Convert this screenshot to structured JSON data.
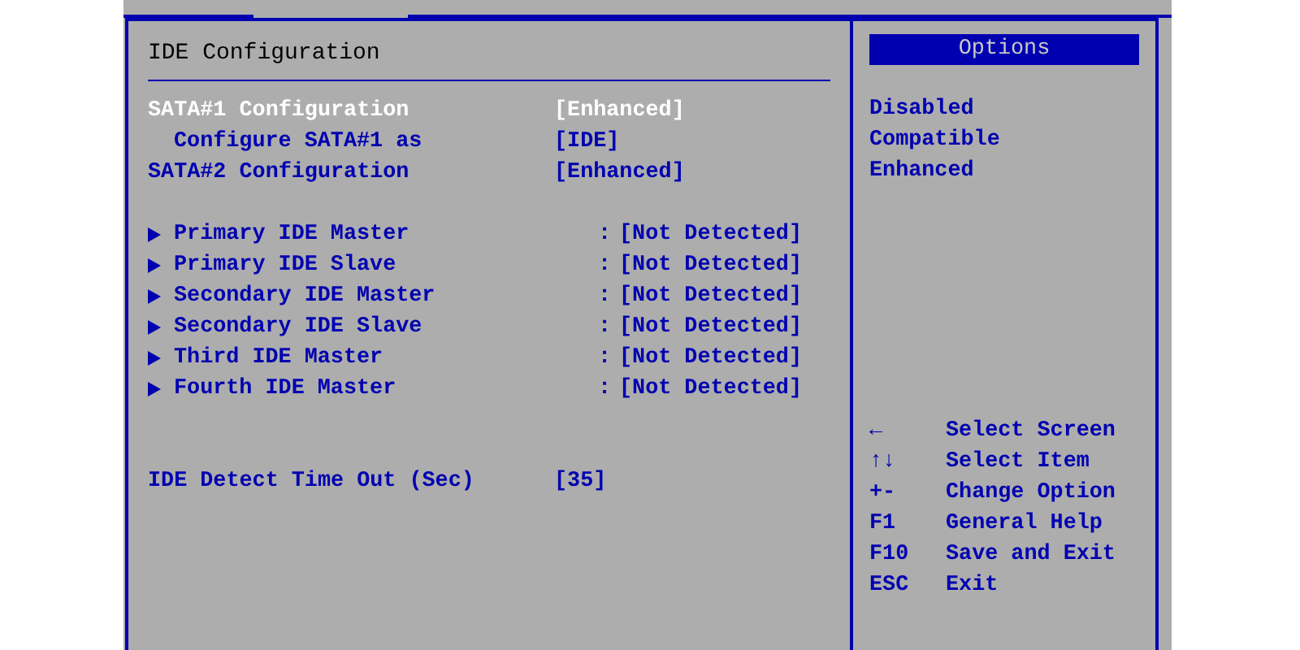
{
  "panel": {
    "title": "IDE Configuration"
  },
  "settings": [
    {
      "kind": "setting",
      "label": "SATA#1 Configuration",
      "value": "[Enhanced]",
      "selected": true,
      "children": [
        {
          "kind": "setting",
          "label": "Configure SATA#1 as",
          "value": "[IDE]",
          "selected": false
        }
      ]
    },
    {
      "kind": "setting",
      "label": "SATA#2 Configuration",
      "value": "[Enhanced]",
      "selected": false
    },
    {
      "kind": "gap"
    },
    {
      "kind": "submenu",
      "label": "Primary IDE Master",
      "separator": ":",
      "value": "[Not Detected]",
      "selected": false
    },
    {
      "kind": "submenu",
      "label": "Primary IDE Slave",
      "separator": ":",
      "value": "[Not Detected]",
      "selected": false
    },
    {
      "kind": "submenu",
      "label": "Secondary IDE Master",
      "separator": ":",
      "value": "[Not Detected]",
      "selected": false
    },
    {
      "kind": "submenu",
      "label": "Secondary IDE Slave",
      "separator": ":",
      "value": "[Not Detected]",
      "selected": false
    },
    {
      "kind": "submenu",
      "label": "Third IDE Master",
      "separator": ":",
      "value": "[Not Detected]",
      "selected": false
    },
    {
      "kind": "submenu",
      "label": "Fourth IDE Master",
      "separator": ":",
      "value": "[Not Detected]",
      "selected": false
    },
    {
      "kind": "gap"
    },
    {
      "kind": "gap"
    },
    {
      "kind": "setting",
      "label": "IDE Detect Time Out (Sec)",
      "value": "[35]",
      "selected": false
    }
  ],
  "options": {
    "title": "Options",
    "items": [
      "Disabled",
      "Compatible",
      "Enhanced"
    ]
  },
  "help": [
    {
      "key": "←",
      "action": "Select Screen"
    },
    {
      "key": "↑↓",
      "action": "Select Item"
    },
    {
      "key": "+-",
      "action": "Change Option"
    },
    {
      "key": "F1",
      "action": "General Help"
    },
    {
      "key": "F10",
      "action": "Save and Exit"
    },
    {
      "key": "ESC",
      "action": "Exit"
    }
  ]
}
